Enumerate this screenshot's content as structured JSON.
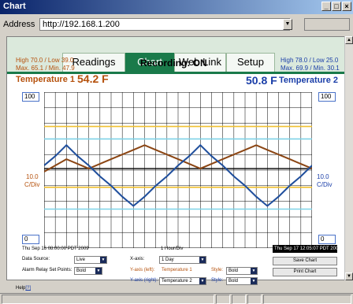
{
  "window": {
    "title": "Chart"
  },
  "address": {
    "label": "Address",
    "value": "http://192.168.1.200"
  },
  "tabs": [
    {
      "label": "Readings",
      "active": false
    },
    {
      "label": "Chart",
      "active": true
    },
    {
      "label": "Web Link",
      "active": false
    },
    {
      "label": "Setup",
      "active": false
    }
  ],
  "sensor1": {
    "hl": "High 70.0 / Low 39.0",
    "maxmin": "Max. 65.1 / Min. 47.9",
    "name": "Temperature 1",
    "value": "54.2 F",
    "color": "#b5510c"
  },
  "sensor2": {
    "hl": "High 78.0 / Low 25.0",
    "maxmin": "Max. 69.9 / Min. 30.1",
    "name": "Temperature 2",
    "value": "50.8 F",
    "color": "#1a3ea8"
  },
  "status": {
    "recording": "Recording: ON"
  },
  "axes": {
    "left_top": "100",
    "left_bottom": "0",
    "right_top": "100",
    "right_bottom": "0",
    "left_div_value": "10.0",
    "left_div_unit": "C/Div",
    "right_div_value": "10.0",
    "right_div_unit": "C/Div",
    "time_div": "1 Hour/Div",
    "start_time": "Thu Sep 16 08:00:00 PDT 2009",
    "end_time": "Thu Sep 17 12:05:07 PDT 2009"
  },
  "chart_data": {
    "type": "line",
    "ylim": [
      0,
      100
    ],
    "x": [
      0,
      1,
      2,
      3,
      4,
      5,
      6,
      7,
      8,
      9,
      10,
      11,
      12,
      13,
      14,
      15,
      16,
      17,
      18,
      19,
      20,
      21,
      22,
      23,
      24
    ],
    "series": [
      {
        "name": "Temperature 1",
        "color": "#8b4513",
        "values": [
          49,
          53,
          57,
          54,
          51,
          54,
          57,
          60,
          63,
          66,
          63,
          60,
          57,
          54,
          51,
          54,
          57,
          60,
          63,
          66,
          63,
          60,
          57,
          54,
          51
        ]
      },
      {
        "name": "Temperature 2",
        "color": "#1f4e9c",
        "values": [
          53,
          59,
          66,
          59,
          53,
          46,
          40,
          33,
          27,
          33,
          40,
          46,
          53,
          59,
          66,
          59,
          53,
          46,
          40,
          33,
          27,
          33,
          40,
          46,
          53
        ]
      }
    ],
    "reference_lines": [
      {
        "value": 78,
        "color": "#f0c030"
      },
      {
        "value": 70,
        "color": "#7fd3e8"
      },
      {
        "value": 39,
        "color": "#f0c030"
      },
      {
        "value": 25,
        "color": "#7fd3e8"
      }
    ],
    "center_line": {
      "value": 51,
      "color": "#000000"
    }
  },
  "controls": {
    "data_source_label": "Data Source:",
    "data_source_value": "Live",
    "x_axis_label": "X-axis:",
    "x_axis_value": "1 Day",
    "save_chart": "Save Chart",
    "alarm_label": "Alarm Relay Set Points:",
    "alarm_value": "Bold",
    "y_left_label": "Y-axis (left):",
    "y_left_value": "Temperature 1",
    "style_label": "Style:",
    "style_left_value": "Bold",
    "print_chart": "Print Chart",
    "y_right_label": "Y-axis (right):",
    "y_right_value": "Temperature 2",
    "style_right_value": "Bold"
  },
  "help": {
    "label": "Help",
    "link": "[?]"
  }
}
